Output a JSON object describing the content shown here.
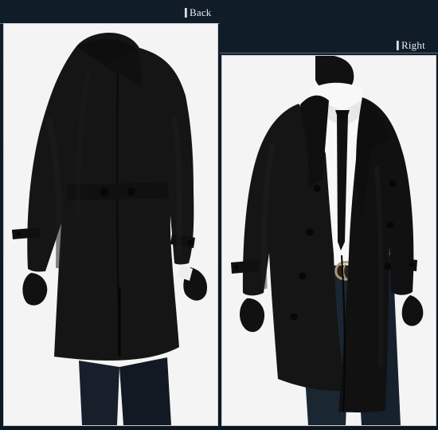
{
  "labels": {
    "back": "Back",
    "right": "Right"
  },
  "icons": {
    "back_marker": "label-marker-icon",
    "right_marker": "label-marker-icon"
  },
  "colors": {
    "background": "#0f1b26",
    "panel": "#f4f4f4",
    "coat": "#151515",
    "shirt": "#f8f8f8",
    "tie": "#111111",
    "jeans": "#1b2633",
    "belt": "#2a2017",
    "buckle": "#a99a7a"
  }
}
